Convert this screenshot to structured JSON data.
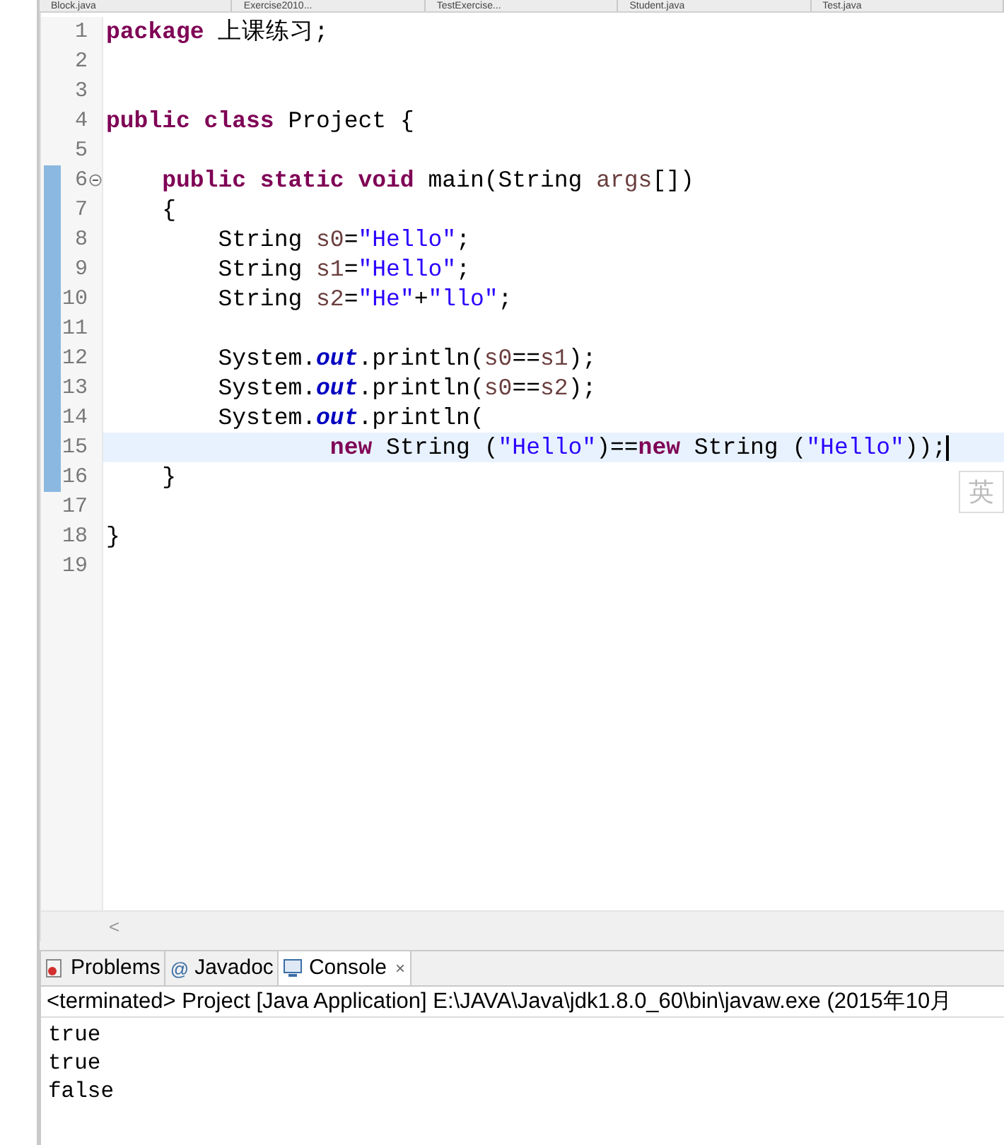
{
  "editor_tabs": [
    {
      "label": "Block.java",
      "selected": false
    },
    {
      "label": "Exercise2010...",
      "selected": false
    },
    {
      "label": "TestExercise...",
      "selected": false
    },
    {
      "label": "Student.java",
      "selected": false
    },
    {
      "label": "Test.java",
      "selected": false
    }
  ],
  "code_lines": [
    {
      "number": "1",
      "changed": false,
      "current": false,
      "foldable": false,
      "tokens": [
        {
          "kind": "keyword",
          "text": "package"
        },
        {
          "kind": "plain",
          "text": " 上课练习;"
        }
      ]
    },
    {
      "number": "2",
      "changed": false,
      "current": false,
      "foldable": false
    },
    {
      "number": "3",
      "changed": false,
      "current": false,
      "foldable": false
    },
    {
      "number": "4",
      "changed": false,
      "current": false,
      "foldable": false,
      "tokens": [
        {
          "kind": "keyword",
          "text": "public class"
        },
        {
          "kind": "plain",
          "text": " Project {"
        }
      ]
    },
    {
      "number": "5",
      "changed": false,
      "current": false,
      "foldable": false
    },
    {
      "number": "6",
      "changed": true,
      "current": false,
      "foldable": true,
      "tokens": [
        {
          "kind": "keyword",
          "text": "    public static void"
        },
        {
          "kind": "plain",
          "text": " main(String "
        },
        {
          "kind": "variable",
          "text": "args"
        },
        {
          "kind": "plain",
          "text": "[])"
        }
      ]
    },
    {
      "number": "7",
      "changed": true,
      "current": false,
      "foldable": false,
      "tokens": [
        {
          "kind": "plain",
          "text": "    {"
        }
      ]
    },
    {
      "number": "8",
      "changed": true,
      "current": false,
      "foldable": false,
      "tokens": [
        {
          "kind": "plain",
          "text": "        String "
        },
        {
          "kind": "variable",
          "text": "s0"
        },
        {
          "kind": "plain",
          "text": "="
        },
        {
          "kind": "string",
          "text": "\"Hello\""
        },
        {
          "kind": "plain",
          "text": ";"
        }
      ]
    },
    {
      "number": "9",
      "changed": true,
      "current": false,
      "foldable": false,
      "tokens": [
        {
          "kind": "plain",
          "text": "        String "
        },
        {
          "kind": "variable",
          "text": "s1"
        },
        {
          "kind": "plain",
          "text": "="
        },
        {
          "kind": "string",
          "text": "\"Hello\""
        },
        {
          "kind": "plain",
          "text": ";"
        }
      ]
    },
    {
      "number": "10",
      "changed": true,
      "current": false,
      "foldable": false,
      "tokens": [
        {
          "kind": "plain",
          "text": "        String "
        },
        {
          "kind": "variable",
          "text": "s2"
        },
        {
          "kind": "plain",
          "text": "="
        },
        {
          "kind": "string",
          "text": "\"He\""
        },
        {
          "kind": "plain",
          "text": "+"
        },
        {
          "kind": "string",
          "text": "\"llo\""
        },
        {
          "kind": "plain",
          "text": ";"
        }
      ]
    },
    {
      "number": "11",
      "changed": true,
      "current": false,
      "foldable": false
    },
    {
      "number": "12",
      "changed": true,
      "current": false,
      "foldable": false,
      "tokens": [
        {
          "kind": "plain",
          "text": "        System."
        },
        {
          "kind": "field",
          "text": "out"
        },
        {
          "kind": "plain",
          "text": ".println("
        },
        {
          "kind": "variable",
          "text": "s0"
        },
        {
          "kind": "plain",
          "text": "=="
        },
        {
          "kind": "variable",
          "text": "s1"
        },
        {
          "kind": "plain",
          "text": ");"
        }
      ]
    },
    {
      "number": "13",
      "changed": true,
      "current": false,
      "foldable": false,
      "tokens": [
        {
          "kind": "plain",
          "text": "        System."
        },
        {
          "kind": "field",
          "text": "out"
        },
        {
          "kind": "plain",
          "text": ".println("
        },
        {
          "kind": "variable",
          "text": "s0"
        },
        {
          "kind": "plain",
          "text": "=="
        },
        {
          "kind": "variable",
          "text": "s2"
        },
        {
          "kind": "plain",
          "text": ");"
        }
      ]
    },
    {
      "number": "14",
      "changed": true,
      "current": false,
      "foldable": false,
      "tokens": [
        {
          "kind": "plain",
          "text": "        System."
        },
        {
          "kind": "field",
          "text": "out"
        },
        {
          "kind": "plain",
          "text": ".println("
        }
      ]
    },
    {
      "number": "15",
      "changed": true,
      "current": true,
      "foldable": false,
      "tokens": [
        {
          "kind": "keyword",
          "text": "                new"
        },
        {
          "kind": "plain",
          "text": " String ("
        },
        {
          "kind": "string",
          "text": "\"Hello\""
        },
        {
          "kind": "plain",
          "text": ")=="
        },
        {
          "kind": "keyword",
          "text": "new"
        },
        {
          "kind": "plain",
          "text": " String ("
        },
        {
          "kind": "string",
          "text": "\"Hello\""
        },
        {
          "kind": "plain",
          "text": "));"
        }
      ]
    },
    {
      "number": "16",
      "changed": true,
      "current": false,
      "foldable": false,
      "tokens": [
        {
          "kind": "plain",
          "text": "    }"
        }
      ]
    },
    {
      "number": "17",
      "changed": false,
      "current": false,
      "foldable": false
    },
    {
      "number": "18",
      "changed": false,
      "current": false,
      "foldable": false,
      "tokens": [
        {
          "kind": "plain",
          "text": "}"
        }
      ]
    },
    {
      "number": "19",
      "changed": false,
      "current": false,
      "foldable": false
    }
  ],
  "ime_indicator": "英",
  "scroll_left": "<",
  "panel_tabs": [
    {
      "kind": "problems",
      "label": "Problems",
      "selected": false
    },
    {
      "kind": "javadoc",
      "icon_text": "@",
      "label": "Javadoc",
      "selected": false
    },
    {
      "kind": "console",
      "label": "Console",
      "close_label": "×",
      "selected": true
    }
  ],
  "console": {
    "header": "<terminated> Project [Java Application] E:\\JAVA\\Java\\jdk1.8.0_60\\bin\\javaw.exe (2015年10月",
    "output": [
      "true",
      "true",
      "false"
    ]
  }
}
